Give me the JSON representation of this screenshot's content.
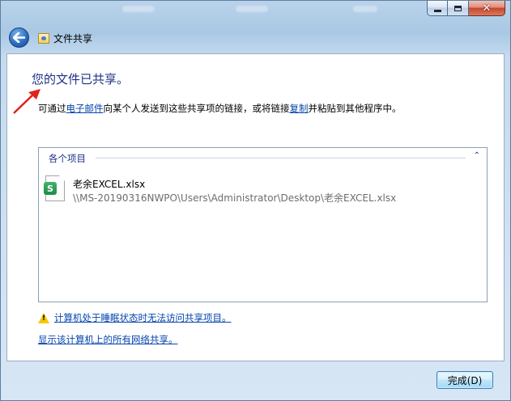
{
  "window": {
    "title": "文件共享",
    "controls": {
      "minimize": "minimize",
      "maximize": "maximize",
      "close": "✕"
    }
  },
  "content": {
    "heading": "您的文件已共享。",
    "desc_prefix": "可通过",
    "email_link": "电子邮件",
    "desc_middle": "向某个人发送到这些共享项的链接，或将链接",
    "copy_link": "复制",
    "desc_suffix": "并粘贴到其他程序中。"
  },
  "items": {
    "header": "各个项目",
    "collapse_glyph": "⌃",
    "files": [
      {
        "name": "老余EXCEL.xlsx",
        "path": "\\\\MS-20190316NWPO\\Users\\Administrator\\Desktop\\老余EXCEL.xlsx",
        "badge": "S",
        "icon": "spreadsheet-file-icon"
      }
    ]
  },
  "links": {
    "sleep_warning": "计算机处于睡眠状态时无法访问共享项目。",
    "show_all": "显示该计算机上的所有网络共享。"
  },
  "buttons": {
    "done": "完成(D)"
  },
  "colors": {
    "heading": "#1e3287",
    "link": "#0645ad",
    "annotation_arrow": "#e0241b",
    "excel_green": "#1d8a45"
  }
}
